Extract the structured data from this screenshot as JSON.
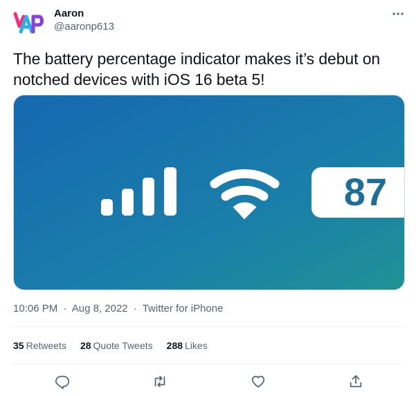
{
  "author": {
    "name": "Aaron",
    "handle": "@aaronp613"
  },
  "tweet": {
    "text": "The battery percentage indicator makes it’s debut on notched devices with iOS 16 beta 5!"
  },
  "media": {
    "battery_percentage": "87"
  },
  "meta": {
    "time": "10:06 PM",
    "separator": "·",
    "date": "Aug 8, 2022",
    "source": "Twitter for iPhone"
  },
  "stats": {
    "retweets_count": "35",
    "retweets_label": "Retweets",
    "quote_count": "28",
    "quote_label": "Quote Tweets",
    "likes_count": "288",
    "likes_label": "Likes"
  },
  "icons": {
    "more": "more-horizontal-icon",
    "reply": "reply-icon",
    "retweet": "retweet-icon",
    "like": "heart-icon",
    "share": "share-icon"
  },
  "colors": {
    "text_primary": "#0f1419",
    "text_secondary": "#536471",
    "divider": "#eff3f4",
    "media_blue": "#1a6fb5",
    "media_teal": "#1f8f9a"
  }
}
